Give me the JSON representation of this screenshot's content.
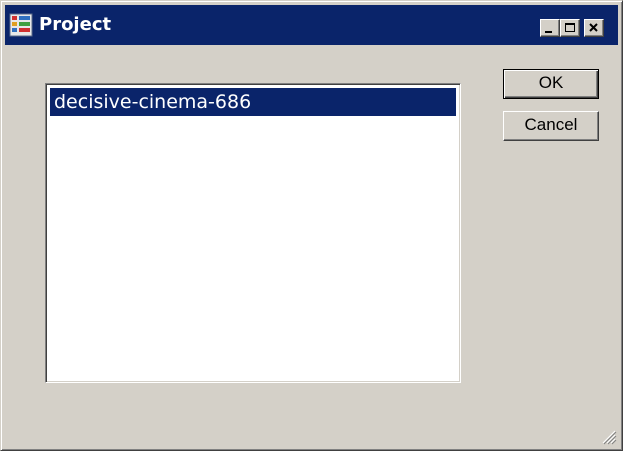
{
  "window": {
    "title": "Project",
    "icon": "project-app-icon",
    "controls": {
      "minimize": "minimize-icon",
      "maximize": "maximize-icon",
      "close": "close-icon"
    }
  },
  "project_list": {
    "items": [
      "decisive-cinema-686"
    ],
    "selected_index": 0
  },
  "buttons": {
    "ok_label": "OK",
    "cancel_label": "Cancel"
  },
  "colors": {
    "titlebar": "#0a246a",
    "selection": "#0a246a",
    "face": "#d4d0c8"
  }
}
